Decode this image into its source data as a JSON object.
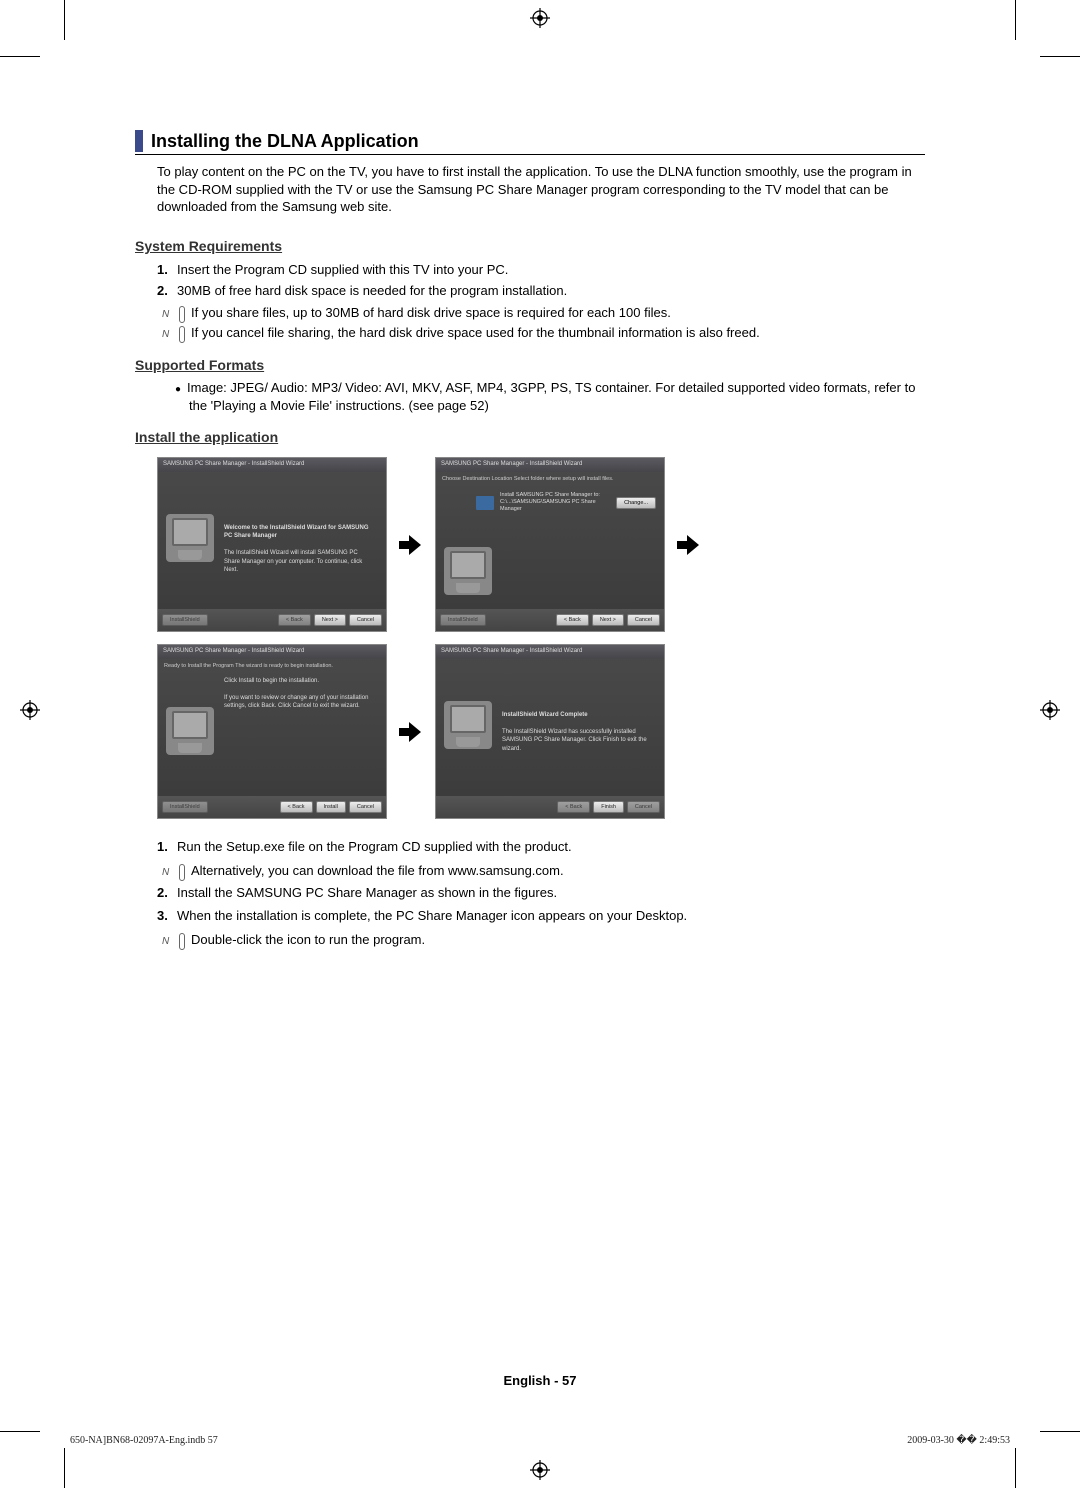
{
  "title": "Installing the DLNA Application",
  "intro": "To play content on the PC on the TV, you have to first install the application. To use the DLNA function smoothly, use the program in the CD-ROM supplied with the TV or use the Samsung PC Share Manager program corresponding to the TV model that can be downloaded from the Samsung web site.",
  "sections": {
    "req": {
      "heading": "System Requirements",
      "items": [
        "Insert the Program CD supplied with this TV into your PC.",
        "30MB of free hard disk space is needed for the program installation."
      ],
      "notes": [
        "If you share files, up to 30MB of hard disk drive space is required for each 100 files.",
        "If you cancel file sharing, the hard disk drive space used for the thumbnail information is also freed."
      ]
    },
    "fmt": {
      "heading": "Supported Formats",
      "bullet": "Image: JPEG/ Audio: MP3/ Video: AVI, MKV, ASF, MP4, 3GPP, PS, TS container. For detailed supported video formats, refer to the 'Playing a Movie File' instructions. (see page 52)"
    },
    "install": {
      "heading": "Install the application",
      "steps": [
        "Run the Setup.exe file on the Program CD supplied with the product.",
        "Install the SAMSUNG PC Share Manager as shown in the figures.",
        "When the installation is complete, the PC Share Manager icon appears on your Desktop."
      ],
      "step_notes": {
        "a": "Alternatively, you can download the file from www.samsung.com.",
        "b": "Double-click the icon to run the program."
      }
    }
  },
  "shots": {
    "title_generic": "SAMSUNG PC Share Manager - InstallShield Wizard",
    "s1_head": "Welcome to the InstallShield Wizard for SAMSUNG PC Share Manager",
    "s1_body": "The InstallShield Wizard will install SAMSUNG PC Share Manager on your computer. To continue, click Next.",
    "s2_sub": "Choose Destination Location\nSelect folder where setup will install files.",
    "s2_body": "Install SAMSUNG PC Share Manager to:\nC:\\...\\SAMSUNG\\SAMSUNG PC Share Manager",
    "s3_sub": "Ready to Install the Program\nThe wizard is ready to begin installation.",
    "s3_head": "Click Install to begin the installation.",
    "s3_body": "If you want to review or change any of your installation settings, click Back. Click Cancel to exit the wizard.",
    "s4_head": "InstallShield Wizard Complete",
    "s4_body": "The InstallShield Wizard has successfully installed SAMSUNG PC Share Manager. Click Finish to exit the wizard.",
    "btn_back": "< Back",
    "btn_next": "Next >",
    "btn_install": "Install",
    "btn_finish": "Finish",
    "btn_cancel": "Cancel",
    "btn_change": "Change...",
    "installshield": "InstallShield"
  },
  "footer": {
    "page": "English - 57",
    "file": "650-NA]BN68-02097A-Eng.indb   57",
    "stamp": "2009-03-30   �� 2:49:53"
  }
}
